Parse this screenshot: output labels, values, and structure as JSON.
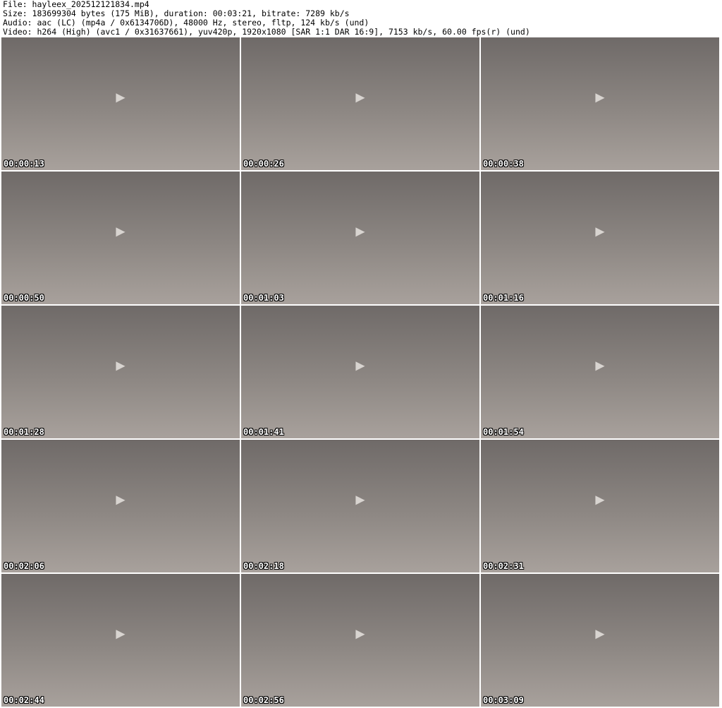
{
  "header": {
    "file": "File: hayleex_202512121834.mp4",
    "size": "Size: 183699304 bytes (175 MiB), duration: 00:03:21, bitrate: 7289 kb/s",
    "audio": "Audio: aac (LC) (mp4a / 0x6134706D), 48000 Hz, stereo, fltp, 124 kb/s (und)",
    "video": "Video: h264 (High) (avc1 / 0x31637661), yuv420p, 1920x1080 [SAR 1:1 DAR 16:9], 7153 kb/s, 60.00 fps(r) (und)"
  },
  "thumbnails": [
    {
      "timestamp": "00:00:13"
    },
    {
      "timestamp": "00:00:26"
    },
    {
      "timestamp": "00:00:38"
    },
    {
      "timestamp": "00:00:50"
    },
    {
      "timestamp": "00:01:03"
    },
    {
      "timestamp": "00:01:16"
    },
    {
      "timestamp": "00:01:28"
    },
    {
      "timestamp": "00:01:41"
    },
    {
      "timestamp": "00:01:54"
    },
    {
      "timestamp": "00:02:06"
    },
    {
      "timestamp": "00:02:18"
    },
    {
      "timestamp": "00:02:31"
    },
    {
      "timestamp": "00:02:44"
    },
    {
      "timestamp": "00:02:56"
    },
    {
      "timestamp": "00:03:09"
    }
  ]
}
